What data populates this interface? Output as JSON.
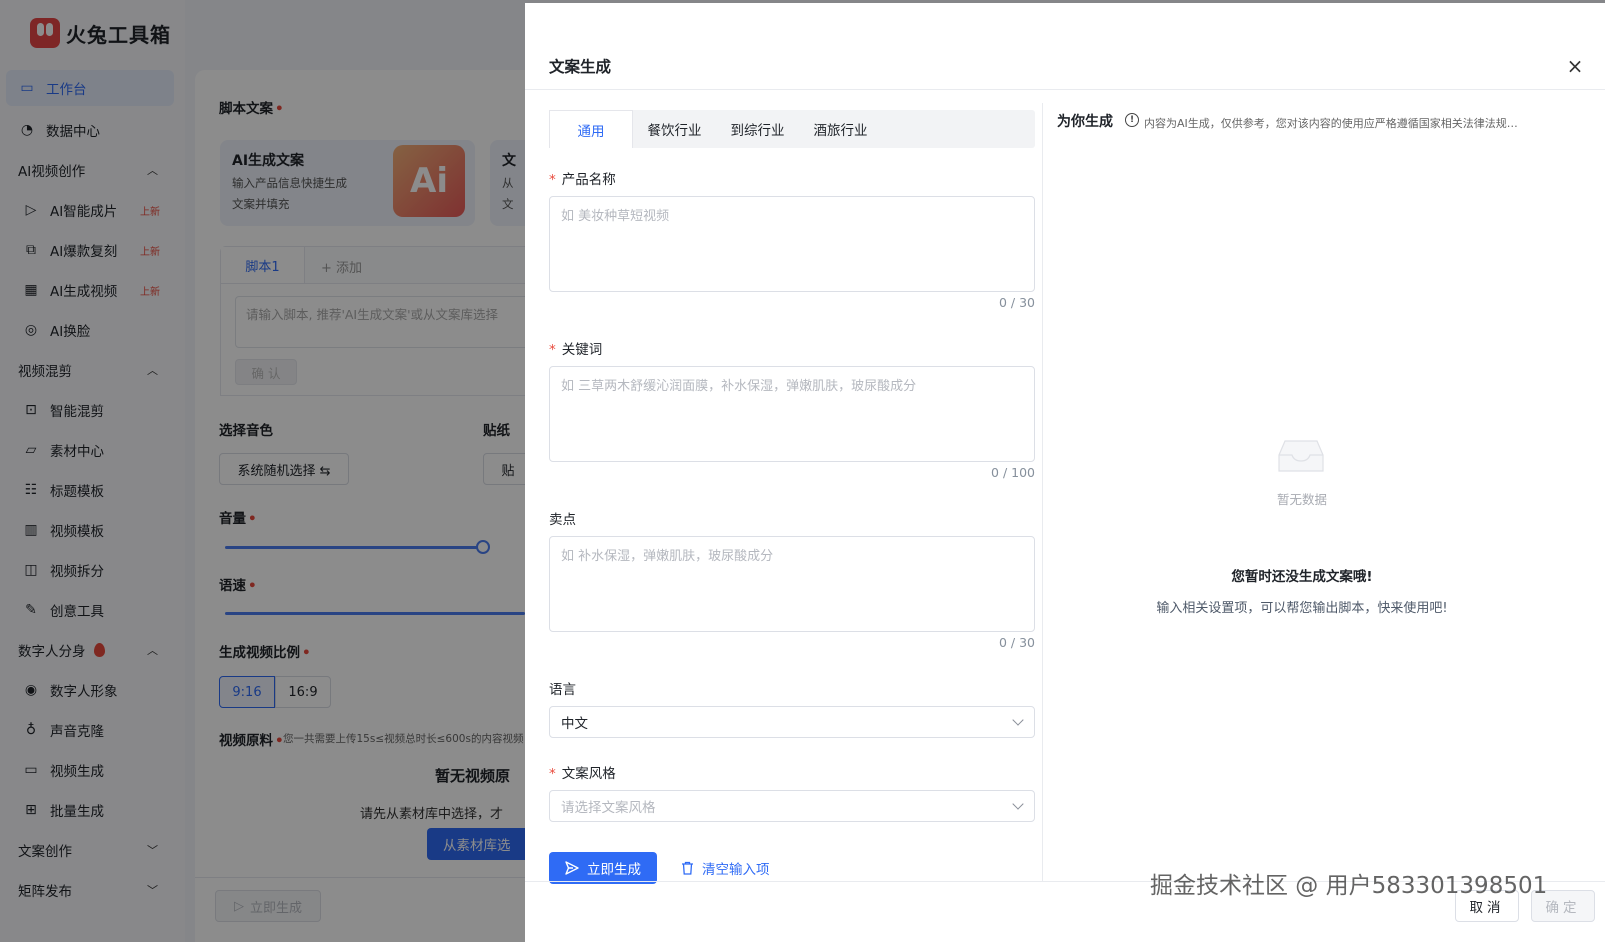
{
  "app": {
    "name": "火兔工具箱",
    "sidebar": {
      "workbench": "工作台",
      "data_center": "数据中心",
      "groups": [
        {
          "label": "AI视频创作",
          "items": [
            {
              "label": "AI智能成片",
              "tag": "上新"
            },
            {
              "label": "AI爆款复刻",
              "tag": "上新"
            },
            {
              "label": "AI生成视频",
              "tag": "上新"
            },
            {
              "label": "AI换脸",
              "tag": ""
            }
          ]
        },
        {
          "label": "视频混剪",
          "items": [
            {
              "label": "智能混剪"
            },
            {
              "label": "素材中心"
            },
            {
              "label": "标题模板"
            },
            {
              "label": "视频模板"
            },
            {
              "label": "视频拆分"
            },
            {
              "label": "创意工具"
            }
          ]
        },
        {
          "label": "数字人分身",
          "items": [
            {
              "label": "数字人形象"
            },
            {
              "label": "声音克隆"
            },
            {
              "label": "视频生成"
            },
            {
              "label": "批量生成"
            }
          ]
        },
        {
          "label": "文案创作",
          "items": []
        },
        {
          "label": "矩阵发布",
          "items": []
        }
      ]
    },
    "main": {
      "script_label": "脚本文案",
      "ai_card_title": "AI生成文案",
      "ai_card_desc": "输入产品信息快捷生成文案并填充",
      "ai_card_badge": "Ai",
      "ai_card2_title": "文",
      "ai_card2_desc_1": "从",
      "ai_card2_desc_2": "文",
      "script_tab": "脚本1",
      "script_add": "+ 添加",
      "script_placeholder": "请输入脚本, 推荐'AI生成文案'或从文案库选择",
      "script_confirm": "确 认",
      "voice_label": "选择音色",
      "voice_button": "系统随机选择 ⇆",
      "sticker_label": "贴纸",
      "sticker_button": "贴",
      "volume_label": "音量",
      "volume_level": 0.98,
      "speed_label": "语速",
      "ratio_label": "生成视频比例",
      "ratios": [
        "9:16",
        "16:9"
      ],
      "raw_label": "视频原料",
      "raw_note": "您一共需要上传15s≤视频总时长≤600s的内容视频",
      "empty_title": "暂无视频原",
      "empty_sub": "请先从素材库中选择，才",
      "library_button": "从素材库选",
      "generate_disabled": "立即生成"
    }
  },
  "drawer": {
    "title": "文案生成",
    "close_icon": "close-icon",
    "tabs": [
      "通用",
      "餐饮行业",
      "到综行业",
      "酒旅行业"
    ],
    "active_tab": "通用",
    "fields": {
      "product_name": {
        "label": "产品名称",
        "placeholder": "如 美妆种草短视频",
        "counter": "0 / 30"
      },
      "keywords": {
        "label": "关键词",
        "placeholder": "如 三草两木舒缓沁润面膜，补水保湿，弹嫩肌肤，玻尿酸成分",
        "counter": "0 / 100"
      },
      "selling_point": {
        "label": "卖点",
        "placeholder": "如 补水保湿，弹嫩肌肤，玻尿酸成分",
        "counter": "0 / 30"
      },
      "language": {
        "label": "语言",
        "value": "中文"
      },
      "style": {
        "label": "文案风格",
        "placeholder": "请选择文案风格"
      }
    },
    "generate_button": "立即生成",
    "clear_button": "清空输入项",
    "result": {
      "title": "为你生成",
      "note": "内容为AI生成，仅供参考，您对该内容的使用应严格遵循国家相关法律法规…",
      "nodata": "暂无数据",
      "none_title": "您暂时还没生成文案哦!",
      "none_sub": "输入相关设置项，可以帮您输出脚本，快来使用吧!"
    },
    "cancel_button": "取消",
    "ok_button": "确定"
  },
  "watermark": "掘金技术社区 @ 用户583301398501",
  "colors": {
    "accent": "#2f6bf5",
    "required": "#e84a3c",
    "brand": "#e64646"
  }
}
